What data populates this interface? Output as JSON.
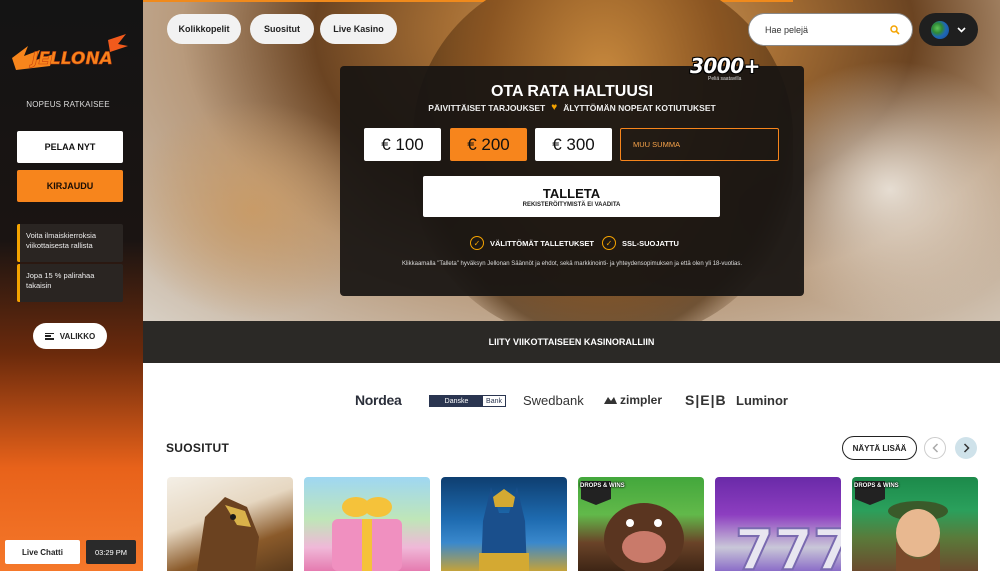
{
  "sidebar": {
    "logo_text": "JELLONA",
    "tagline": "NOPEUS RATKAISEE",
    "play_label": "PELAA NYT",
    "login_label": "KIRJAUDU",
    "promos": [
      "Voita ilmaiskierroksia viikottaisesta rallista",
      "Jopa 15 % palirahaa takaisin"
    ],
    "menu_label": "VALIKKO",
    "chat_label": "Live Chatti",
    "time": "03:29 PM"
  },
  "nav": {
    "pills": [
      "Kolikkopelit",
      "Suositut",
      "Live Kasino"
    ],
    "search_placeholder": "Hae pelejä"
  },
  "deposit": {
    "badge_number": "3000+",
    "badge_caption": "Peliä saatavilla",
    "title": "OTA RATA HALTUUSI",
    "subtitle_left": "PÄIVITTÄISET TARJOUKSET",
    "subtitle_right": "ÄLYTTÖMÄN NOPEAT KOTIUTUKSET",
    "amounts": [
      "€ 100",
      "€ 200",
      "€ 300"
    ],
    "selected_amount": "€ 200",
    "other_amount_placeholder": "MUU SUMMA",
    "deposit_label": "TALLETA",
    "deposit_sublabel": "REKISTERÖITYMISTÄ EI VAADITA",
    "features": [
      "VÄLITTÖMÄT TALLETUKSET",
      "SSL-SUOJATTU"
    ],
    "legal": "Klikkaamalla \"Talleta\" hyväksyn Jellonan Säännöt ja ehdot, sekä markkinointi- ja yhteydensopimuksen ja että olen yli 18-vuotias."
  },
  "rally_banner": "LIITY VIIKOTTAISEEN KASINORALLIIN",
  "banks": {
    "nordea": "Nordea",
    "danske_left": "Danske",
    "danske_right": "Bank",
    "swedbank": "Swedbank",
    "zimpler": "zimpler",
    "seb": "S|E|B",
    "luminor": "Luminor"
  },
  "popular": {
    "title": "SUOSITUT",
    "show_more": "NÄYTÄ LISÄÄ",
    "drops_badge": "DROPS & WINS"
  },
  "colors": {
    "accent_orange": "#f7851c",
    "accent_yellow": "#f5a300",
    "dark": "#181412"
  }
}
